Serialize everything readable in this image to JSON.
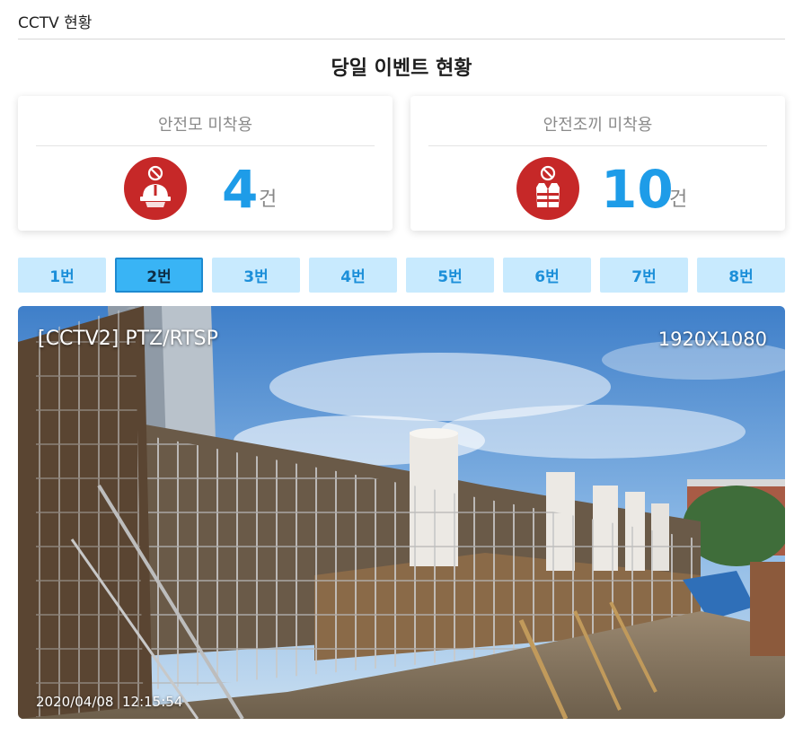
{
  "header": {
    "title": "CCTV 현황"
  },
  "panel": {
    "title": "당일 이벤트 현황"
  },
  "cards": [
    {
      "title": "안전모 미착용",
      "count": "4",
      "unit": "건",
      "icon": "helmet-prohibited-icon"
    },
    {
      "title": "안전조끼 미착용",
      "count": "10",
      "unit": "건",
      "icon": "vest-prohibited-icon"
    }
  ],
  "tabs": [
    {
      "label": "1번"
    },
    {
      "label": "2번"
    },
    {
      "label": "3번"
    },
    {
      "label": "4번"
    },
    {
      "label": "5번"
    },
    {
      "label": "6번"
    },
    {
      "label": "7번"
    },
    {
      "label": "8번"
    }
  ],
  "active_tab": "2번",
  "camera": {
    "label": "[CCTV2] PTZ/RTSP",
    "resolution": "1920X1080",
    "timestamp": "2020/04/08  12:15:54"
  },
  "colors": {
    "accent": "#1e9ce8",
    "tab_bg": "#c8eafe",
    "tab_active_bg": "#39b4f5",
    "alert_red": "#c62828"
  }
}
